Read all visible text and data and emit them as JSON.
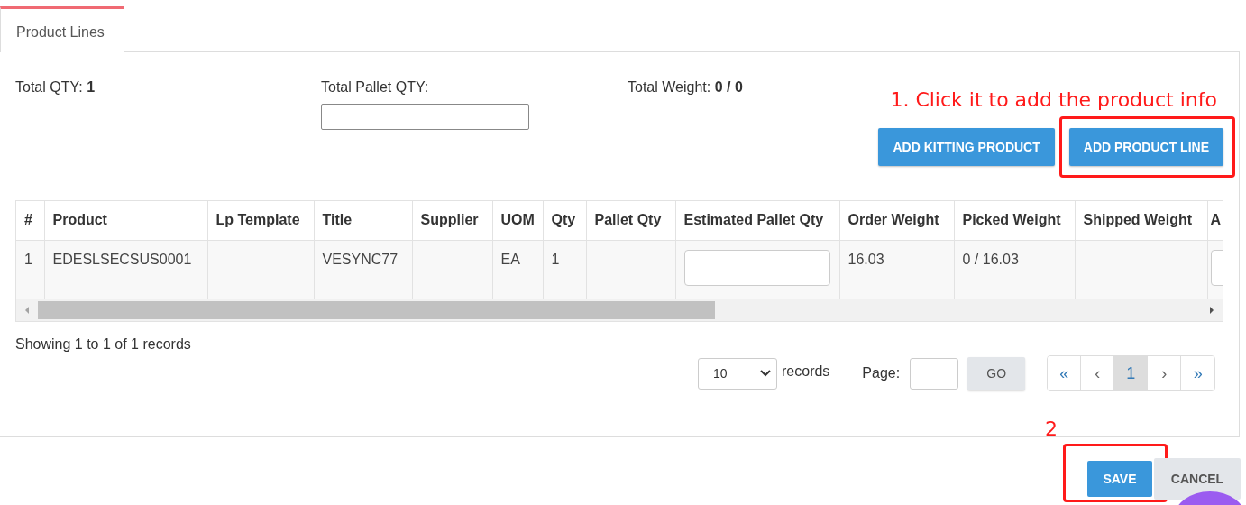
{
  "tabs": [
    {
      "label": "Product Lines",
      "selected": true
    }
  ],
  "totals": {
    "qty_label": "Total QTY:",
    "qty": "1",
    "pallet_label": "Total Pallet QTY:",
    "weight_label": "Total Weight:",
    "weight": "0 / 0"
  },
  "annotations": {
    "step_1": "1. Click it to add the product info",
    "step_2": "2"
  },
  "actions": [
    {
      "label": "ADD KITTING PRODUCT",
      "highlighted": false
    },
    {
      "label": "ADD PRODUCT LINE",
      "highlighted": true
    }
  ],
  "table": {
    "columns": [
      "#",
      "Product",
      "Lp Template",
      "Title",
      "Supplier",
      "UOM",
      "Qty",
      "Pallet Qty",
      "Estimated Pallet Qty",
      "Order Weight",
      "Picked Weight",
      "Shipped Weight",
      "A"
    ],
    "rows": [
      {
        "cells": [
          {
            "kind": "text",
            "text": "1"
          },
          {
            "kind": "text",
            "text": "EDESLSECSUS0001"
          },
          {
            "kind": "text"
          },
          {
            "kind": "text",
            "text": "VESYNC77"
          },
          {
            "kind": "text"
          },
          {
            "kind": "text",
            "text": "EA"
          },
          {
            "kind": "text",
            "text": "1"
          },
          {
            "kind": "text"
          },
          {
            "kind": "input"
          },
          {
            "kind": "text",
            "text": "16.03"
          },
          {
            "kind": "text",
            "text": "0 / 16.03"
          },
          {
            "kind": "text"
          },
          {
            "kind": "input"
          }
        ]
      }
    ]
  },
  "summary": "Showing 1 to 1 of 1 records",
  "pagination": {
    "page_size": "10",
    "records_label": "records",
    "page_label": "Page:",
    "go": "GO",
    "pages": [
      {
        "label": "«",
        "selected": false
      },
      {
        "label": "‹",
        "selected": false
      },
      {
        "label": "1",
        "selected": true
      },
      {
        "label": "›",
        "selected": false
      },
      {
        "label": "»",
        "selected": false
      }
    ]
  },
  "footer": [
    {
      "label": "SAVE",
      "kind": "primary",
      "highlighted": true
    },
    {
      "label": "CANCEL",
      "kind": "secondary",
      "highlighted": false
    }
  ]
}
